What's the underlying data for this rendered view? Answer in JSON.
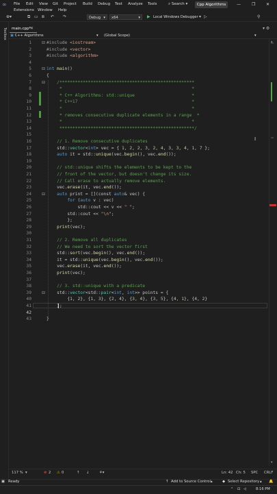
{
  "menu": {
    "row1": [
      "File",
      "Edit",
      "View",
      "Git",
      "Project",
      "Build",
      "Debug",
      "Test",
      "Analyze",
      "Tools"
    ],
    "row2": [
      "Extensions",
      "Window",
      "Help"
    ]
  },
  "search_label": "Search",
  "app_title": "Cpp Algorithms",
  "toolbar": {
    "config": "Debug",
    "platform": "x64",
    "run_label": "Local Windows Debugger"
  },
  "left_rail_label": "Toolbox",
  "tab": {
    "label": "main.cpp*"
  },
  "navbar": {
    "project": "C++ Algorithms",
    "scope": "(Global Scope)"
  },
  "code_lines": [
    {
      "n": "1",
      "t": [
        [
          "cp",
          "#include "
        ],
        [
          "cs",
          "<iostream>"
        ]
      ]
    },
    {
      "n": "2",
      "t": [
        [
          "cp",
          "#include "
        ],
        [
          "cs",
          "<vector>"
        ]
      ]
    },
    {
      "n": "3",
      "t": [
        [
          "cp",
          "#include "
        ],
        [
          "cs",
          "<algorithm>"
        ]
      ]
    },
    {
      "n": "4",
      "t": []
    },
    {
      "n": "5",
      "t": [
        [
          "ck",
          "int "
        ],
        [
          "cf",
          "main"
        ],
        [
          "cm",
          "()"
        ]
      ]
    },
    {
      "n": "6",
      "t": [
        [
          "cm",
          "{"
        ]
      ]
    },
    {
      "n": "7",
      "t": [
        [
          "cg",
          "    /****************************************************"
        ]
      ]
    },
    {
      "n": "8",
      "t": [
        [
          "cg",
          "     *                                                  *"
        ]
      ]
    },
    {
      "n": "9",
      "t": [
        [
          "cg",
          "     * C++ Algorithms: std::unique                      *"
        ]
      ]
    },
    {
      "n": "10",
      "t": [
        [
          "cg",
          "     * C++17                                            *"
        ]
      ]
    },
    {
      "n": "11",
      "t": [
        [
          "cg",
          "     *                                                  *"
        ]
      ]
    },
    {
      "n": "12",
      "t": [
        [
          "cg",
          "     * removes consecutive duplicate elements in a range  *"
        ]
      ]
    },
    {
      "n": "13",
      "t": [
        [
          "cg",
          "     *                                                  *"
        ]
      ]
    },
    {
      "n": "14",
      "t": [
        [
          "cg",
          "     ****************************************************/"
        ]
      ]
    },
    {
      "n": "15",
      "t": []
    },
    {
      "n": "16",
      "t": [
        [
          "cg",
          "    // 1. Remove consecutive duplicates"
        ]
      ]
    },
    {
      "n": "17",
      "t": [
        [
          "cm",
          "    std::"
        ],
        [
          "ct",
          "vector"
        ],
        [
          "cm",
          "<"
        ],
        [
          "ck",
          "int"
        ],
        [
          "cm",
          "> vec = { "
        ],
        [
          "cn",
          "1, 2, 2, 3, 2, 4, 3, 3, 4, 1, 7"
        ],
        [
          "cm",
          " };"
        ]
      ]
    },
    {
      "n": "18",
      "t": [
        [
          "ck",
          "    auto "
        ],
        [
          "cm",
          "it = std::"
        ],
        [
          "cf",
          "unique"
        ],
        [
          "cm",
          "(vec."
        ],
        [
          "cf",
          "begin"
        ],
        [
          "cm",
          "(), vec."
        ],
        [
          "cf",
          "end"
        ],
        [
          "cm",
          "());"
        ]
      ]
    },
    {
      "n": "19",
      "t": []
    },
    {
      "n": "20",
      "t": [
        [
          "cg",
          "    // std::unique shifts the elements to be kept to the"
        ]
      ]
    },
    {
      "n": "21",
      "t": [
        [
          "cg",
          "    // front of the vector, but doesn't change its size."
        ]
      ]
    },
    {
      "n": "22",
      "t": [
        [
          "cg",
          "    // Call erase to actually remove elements."
        ]
      ]
    },
    {
      "n": "23",
      "t": [
        [
          "cm",
          "    vec."
        ],
        [
          "cf",
          "erase"
        ],
        [
          "cm",
          "(it, vec."
        ],
        [
          "cf",
          "end"
        ],
        [
          "cm",
          "());"
        ]
      ]
    },
    {
      "n": "24",
      "t": [
        [
          "ck",
          "    auto "
        ],
        [
          "cm",
          "print = [](const "
        ],
        [
          "ck",
          "auto"
        ],
        [
          "cm",
          "& vec) {"
        ]
      ]
    },
    {
      "n": "25",
      "t": [
        [
          "ck",
          "        for "
        ],
        [
          "cm",
          "("
        ],
        [
          "ck",
          "auto "
        ],
        [
          "cm",
          "v : vec)"
        ]
      ]
    },
    {
      "n": "26",
      "t": [
        [
          "cm",
          "            std::cout << v << "
        ],
        [
          "cs",
          "\" \""
        ],
        [
          "cm",
          ";"
        ]
      ]
    },
    {
      "n": "27",
      "t": [
        [
          "cm",
          "        std::cout << "
        ],
        [
          "cs",
          "\"\\n\""
        ],
        [
          "cm",
          ";"
        ]
      ]
    },
    {
      "n": "28",
      "t": [
        [
          "cm",
          "        };"
        ]
      ]
    },
    {
      "n": "29",
      "t": [
        [
          "cf",
          "    print"
        ],
        [
          "cm",
          "(vec);"
        ]
      ]
    },
    {
      "n": "30",
      "t": []
    },
    {
      "n": "31",
      "t": [
        [
          "cg",
          "    // 2. Remove all duplicates"
        ]
      ]
    },
    {
      "n": "32",
      "t": [
        [
          "cg",
          "    // We need to sort the vector first"
        ]
      ]
    },
    {
      "n": "33",
      "t": [
        [
          "cm",
          "    std::"
        ],
        [
          "cf",
          "sort"
        ],
        [
          "cm",
          "(vec."
        ],
        [
          "cf",
          "begin"
        ],
        [
          "cm",
          "(), vec."
        ],
        [
          "cf",
          "end"
        ],
        [
          "cm",
          "());"
        ]
      ]
    },
    {
      "n": "34",
      "t": [
        [
          "cm",
          "    it = std::"
        ],
        [
          "cf",
          "unique"
        ],
        [
          "cm",
          "(vec."
        ],
        [
          "cf",
          "begin"
        ],
        [
          "cm",
          "(), vec."
        ],
        [
          "cf",
          "end"
        ],
        [
          "cm",
          "());"
        ]
      ]
    },
    {
      "n": "35",
      "t": [
        [
          "cm",
          "    vec."
        ],
        [
          "cf",
          "erase"
        ],
        [
          "cm",
          "(it, vec."
        ],
        [
          "cf",
          "end"
        ],
        [
          "cm",
          "());"
        ]
      ]
    },
    {
      "n": "36",
      "t": [
        [
          "cf",
          "    print"
        ],
        [
          "cm",
          "(vec);"
        ]
      ]
    },
    {
      "n": "37",
      "t": []
    },
    {
      "n": "38",
      "t": [
        [
          "cg",
          "    // 3. std::unique with a predicate"
        ]
      ]
    },
    {
      "n": "39",
      "t": [
        [
          "cm",
          "    std::"
        ],
        [
          "ct",
          "vector"
        ],
        [
          "cm",
          "<std::"
        ],
        [
          "ct",
          "pair"
        ],
        [
          "cm",
          "<"
        ],
        [
          "ck",
          "int"
        ],
        [
          "cm",
          ", "
        ],
        [
          "ck",
          "int"
        ],
        [
          "cm",
          ">> points = {"
        ]
      ]
    },
    {
      "n": "40",
      "t": [
        [
          "cm",
          "        {"
        ],
        [
          "cn",
          "1, 2"
        ],
        [
          "cm",
          "}, {"
        ],
        [
          "cn",
          "1, 3"
        ],
        [
          "cm",
          "}, {"
        ],
        [
          "cn",
          "2, 4"
        ],
        [
          "cm",
          "}, {"
        ],
        [
          "cn",
          "3, 4"
        ],
        [
          "cm",
          "}, {"
        ],
        [
          "cn",
          "3, 5"
        ],
        [
          "cm",
          "}, {"
        ],
        [
          "cn",
          "4, 1"
        ],
        [
          "cm",
          "}, {"
        ],
        [
          "cn",
          "4, 2"
        ],
        [
          "cm",
          "}"
        ]
      ]
    },
    {
      "n": "41",
      "t": [
        [
          "cm",
          "    };"
        ]
      ]
    },
    {
      "n": "42",
      "t": []
    },
    {
      "n": "43",
      "t": [
        [
          "cm",
          "}"
        ]
      ]
    }
  ],
  "editor_status": {
    "zoom": "117 %",
    "errors": "2",
    "warnings": "0",
    "line": "Ln: 42",
    "col": "Ch: 5",
    "spc": "SPC",
    "eol": "CRLF"
  },
  "statusbar": {
    "ready": "Ready",
    "source_control": "Add to Source Control",
    "repository": "Select Repository"
  },
  "taskbar": {
    "time": "8:16 PM"
  },
  "colors": {
    "accent": "#4b9ed6",
    "comment": "#57a64a",
    "keyword": "#569cd6",
    "type": "#4ec9b0",
    "string": "#d69d85"
  }
}
